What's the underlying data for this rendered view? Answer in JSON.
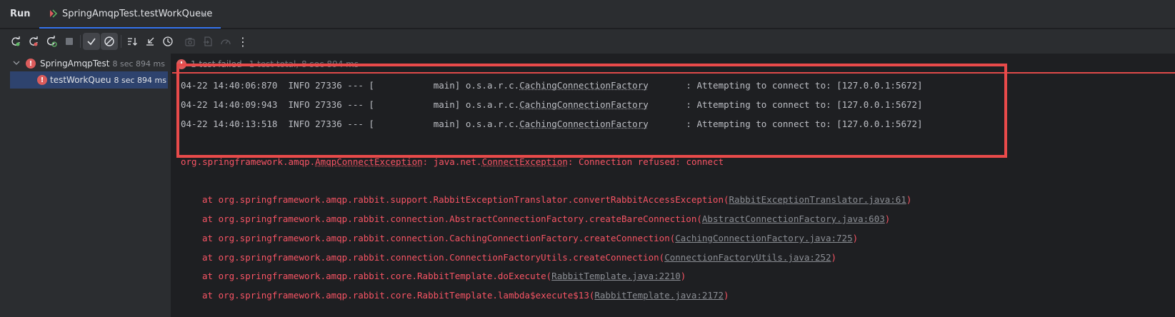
{
  "topbar": {
    "run_label": "Run",
    "tab_title": "SpringAmqpTest.testWorkQueue",
    "tab_close": "×"
  },
  "toolbar": {
    "icons": [
      "rerun-icon",
      "rerun-failed-icon",
      "toggle-auto-test-icon",
      "stop-icon",
      "show-passed-icon",
      "show-ignored-icon",
      "sort-icon",
      "collapse-icon",
      "history-icon",
      "screenshot-icon",
      "export-icon",
      "coverage-icon",
      "more-icon"
    ],
    "more_label": "⋮"
  },
  "tree": {
    "root": {
      "name": "SpringAmqpTest",
      "time": "8 sec 894 ms",
      "status": "!"
    },
    "child": {
      "name": "testWorkQueu",
      "time": "8 sec 894 ms",
      "status": "!"
    }
  },
  "console": {
    "status_failed": "1 test failed",
    "status_total": "1 test total, 8 sec 894 ms",
    "logs": [
      {
        "prefix": "04-22 14:40:06:870  INFO 27336 --- [           main] o.s.a.r.c.",
        "cls": "CachingConnectionFactory",
        "suffix": "       : Attempting to connect to: [127.0.0.1:5672]"
      },
      {
        "prefix": "04-22 14:40:09:943  INFO 27336 --- [           main] o.s.a.r.c.",
        "cls": "CachingConnectionFactory",
        "suffix": "       : Attempting to connect to: [127.0.0.1:5672]"
      },
      {
        "prefix": "04-22 14:40:13:518  INFO 27336 --- [           main] o.s.a.r.c.",
        "cls": "CachingConnectionFactory",
        "suffix": "       : Attempting to connect to: [127.0.0.1:5672]"
      }
    ],
    "exception": {
      "p1": "org.springframework.amqp.",
      "u1": "AmqpConnectException",
      "p2": ": java.net.",
      "u2": "ConnectException",
      "p3": ": Connection refused: connect"
    },
    "stack": [
      {
        "text": "at org.springframework.amqp.rabbit.support.RabbitExceptionTranslator.convertRabbitAccessException(",
        "link": "RabbitExceptionTranslator.java:61",
        "end": ")"
      },
      {
        "text": "at org.springframework.amqp.rabbit.connection.AbstractConnectionFactory.createBareConnection(",
        "link": "AbstractConnectionFactory.java:603",
        "end": ")"
      },
      {
        "text": "at org.springframework.amqp.rabbit.connection.CachingConnectionFactory.createConnection(",
        "link": "CachingConnectionFactory.java:725",
        "end": ")"
      },
      {
        "text": "at org.springframework.amqp.rabbit.connection.ConnectionFactoryUtils.createConnection(",
        "link": "ConnectionFactoryUtils.java:252",
        "end": ")"
      },
      {
        "text": "at org.springframework.amqp.rabbit.core.RabbitTemplate.doExecute(",
        "link": "RabbitTemplate.java:2210",
        "end": ")"
      },
      {
        "text": "at org.springframework.amqp.rabbit.core.RabbitTemplate.lambda$execute$13(",
        "link": "RabbitTemplate.java:2172",
        "end": ")"
      }
    ]
  },
  "colors": {
    "error": "#f75464",
    "highlight": "#e84a4a",
    "selection": "#2e436e",
    "accent": "#3574f0"
  }
}
